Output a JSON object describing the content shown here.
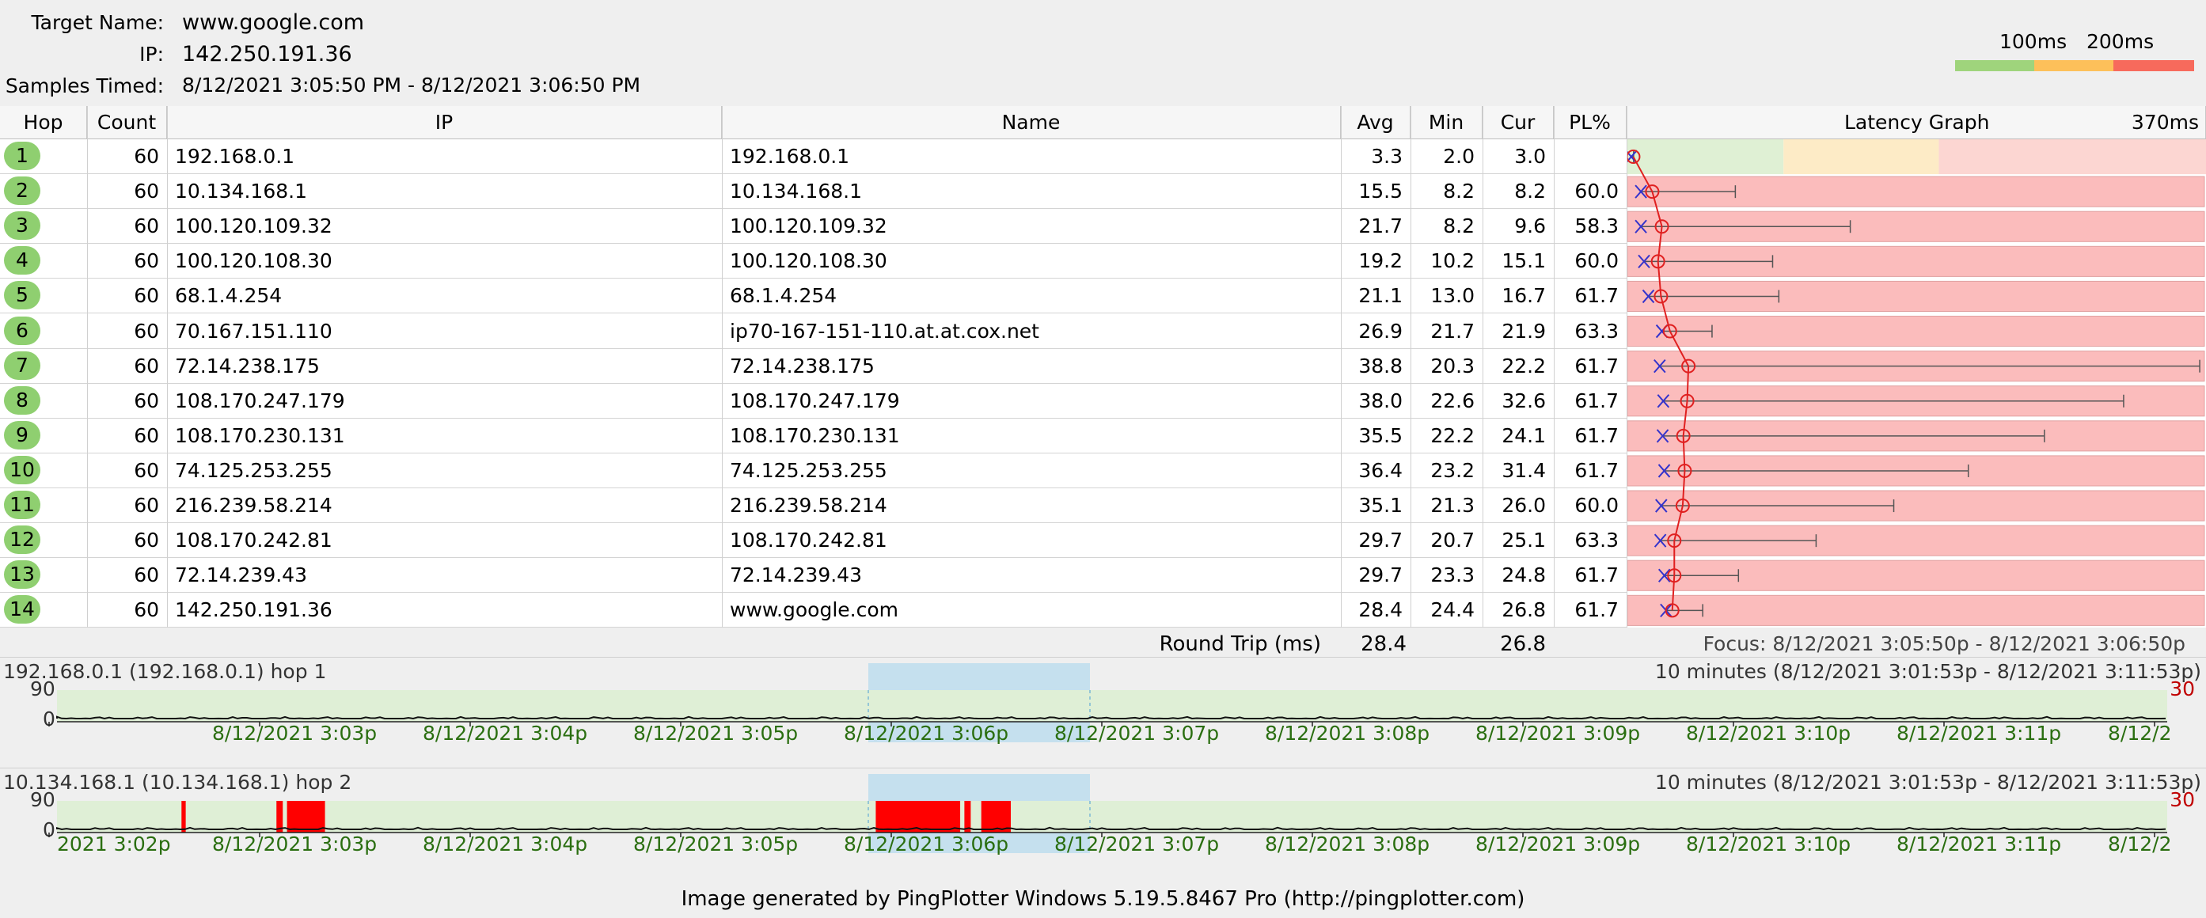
{
  "header": {
    "target_label": "Target Name:",
    "target_value": "www.google.com",
    "ip_label": "IP:",
    "ip_value": "142.250.191.36",
    "samples_label": "Samples Timed:",
    "samples_value": "8/12/2021 3:05:50 PM - 8/12/2021 3:06:50 PM"
  },
  "legend": {
    "label_100": "100ms",
    "label_200": "200ms",
    "colors": [
      "#9fd47c",
      "#fdc05a",
      "#f76a5c"
    ]
  },
  "columns": {
    "hop": "Hop",
    "count": "Count",
    "ip": "IP",
    "name": "Name",
    "avg": "Avg",
    "min": "Min",
    "cur": "Cur",
    "pl": "PL%",
    "graph": "Latency Graph",
    "graph_max": "370ms"
  },
  "graph_max_ms": 370,
  "rows": [
    {
      "hop": "1",
      "count": "60",
      "ip": "192.168.0.1",
      "name": "192.168.0.1",
      "avg": "3.3",
      "min": "2.0",
      "cur": "3.0",
      "pl": "",
      "max_ms": 3.5
    },
    {
      "hop": "2",
      "count": "60",
      "ip": "10.134.168.1",
      "name": "10.134.168.1",
      "avg": "15.5",
      "min": "8.2",
      "cur": "8.2",
      "pl": "60.0",
      "max_ms": 69
    },
    {
      "hop": "3",
      "count": "60",
      "ip": "100.120.109.32",
      "name": "100.120.109.32",
      "avg": "21.7",
      "min": "8.2",
      "cur": "9.6",
      "pl": "58.3",
      "max_ms": 143
    },
    {
      "hop": "4",
      "count": "60",
      "ip": "100.120.108.30",
      "name": "100.120.108.30",
      "avg": "19.2",
      "min": "10.2",
      "cur": "15.1",
      "pl": "60.0",
      "max_ms": 93
    },
    {
      "hop": "5",
      "count": "60",
      "ip": "68.1.4.254",
      "name": "68.1.4.254",
      "avg": "21.1",
      "min": "13.0",
      "cur": "16.7",
      "pl": "61.7",
      "max_ms": 97
    },
    {
      "hop": "6",
      "count": "60",
      "ip": "70.167.151.110",
      "name": "ip70-167-151-110.at.at.cox.net",
      "avg": "26.9",
      "min": "21.7",
      "cur": "21.9",
      "pl": "63.3",
      "max_ms": 54
    },
    {
      "hop": "7",
      "count": "60",
      "ip": "72.14.238.175",
      "name": "72.14.238.175",
      "avg": "38.8",
      "min": "20.3",
      "cur": "22.2",
      "pl": "61.7",
      "max_ms": 368
    },
    {
      "hop": "8",
      "count": "60",
      "ip": "108.170.247.179",
      "name": "108.170.247.179",
      "avg": "38.0",
      "min": "22.6",
      "cur": "32.6",
      "pl": "61.7",
      "max_ms": 319
    },
    {
      "hop": "9",
      "count": "60",
      "ip": "108.170.230.131",
      "name": "108.170.230.131",
      "avg": "35.5",
      "min": "22.2",
      "cur": "24.1",
      "pl": "61.7",
      "max_ms": 268
    },
    {
      "hop": "10",
      "count": "60",
      "ip": "74.125.253.255",
      "name": "74.125.253.255",
      "avg": "36.4",
      "min": "23.2",
      "cur": "31.4",
      "pl": "61.7",
      "max_ms": 219
    },
    {
      "hop": "11",
      "count": "60",
      "ip": "216.239.58.214",
      "name": "216.239.58.214",
      "avg": "35.1",
      "min": "21.3",
      "cur": "26.0",
      "pl": "60.0",
      "max_ms": 171
    },
    {
      "hop": "12",
      "count": "60",
      "ip": "108.170.242.81",
      "name": "108.170.242.81",
      "avg": "29.7",
      "min": "20.7",
      "cur": "25.1",
      "pl": "63.3",
      "max_ms": 121
    },
    {
      "hop": "13",
      "count": "60",
      "ip": "72.14.239.43",
      "name": "72.14.239.43",
      "avg": "29.7",
      "min": "23.3",
      "cur": "24.8",
      "pl": "61.7",
      "max_ms": 71
    },
    {
      "hop": "14",
      "count": "60",
      "ip": "142.250.191.36",
      "name": "www.google.com",
      "avg": "28.4",
      "min": "24.4",
      "cur": "26.8",
      "pl": "61.7",
      "max_ms": 48
    }
  ],
  "round_trip": {
    "label": "Round Trip (ms)",
    "avg": "28.4",
    "cur": "26.8",
    "focus": "Focus: 8/12/2021 3:05:50p - 8/12/2021 3:06:50p"
  },
  "timeseries": [
    {
      "title": "192.168.0.1 (192.168.0.1) hop 1",
      "range": "10 minutes (8/12/2021 3:01:53p - 8/12/2021 3:11:53p)",
      "y_top": "90",
      "y_bottom": "0",
      "right_value": "30",
      "axis_labels": [
        "8/12/2021 3:03p",
        "8/12/2021 3:04p",
        "8/12/2021 3:05p",
        "8/12/2021 3:06p",
        "8/12/2021 3:07p",
        "8/12/2021 3:08p",
        "8/12/2021 3:09p",
        "8/12/2021 3:10p",
        "8/12/2021 3:11p"
      ],
      "axis_left_partial": "",
      "axis_right_partial": "8/12/2",
      "loss_spans": []
    },
    {
      "title": "10.134.168.1 (10.134.168.1) hop 2",
      "range": "10 minutes (8/12/2021 3:01:53p - 8/12/2021 3:11:53p)",
      "y_top": "90",
      "y_bottom": "0",
      "right_value": "30",
      "axis_labels": [
        "8/12/2021 3:03p",
        "8/12/2021 3:04p",
        "8/12/2021 3:05p",
        "8/12/2021 3:06p",
        "8/12/2021 3:07p",
        "8/12/2021 3:08p",
        "8/12/2021 3:09p",
        "8/12/2021 3:10p",
        "8/12/2021 3:11p"
      ],
      "axis_left_partial": "2021 3:02p",
      "axis_right_partial": "8/12/2",
      "loss_spans": [
        [
          0.059,
          0.061
        ],
        [
          0.104,
          0.107
        ],
        [
          0.109,
          0.127
        ],
        [
          0.388,
          0.428
        ],
        [
          0.43,
          0.433
        ],
        [
          0.438,
          0.452
        ]
      ]
    }
  ],
  "footer": "Image generated by PingPlotter Windows 5.19.5.8467 Pro (http://pingplotter.com)"
}
